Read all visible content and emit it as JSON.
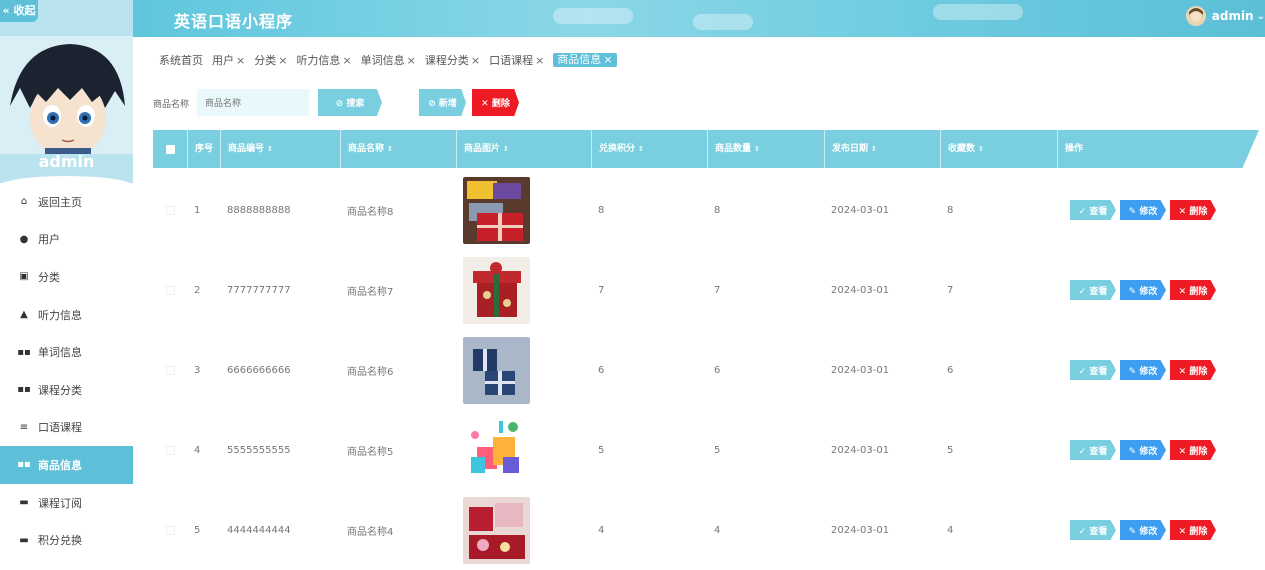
{
  "app": {
    "title": "英语口语小程序"
  },
  "user": {
    "name": "admin",
    "caret": "⌄"
  },
  "sidebar": {
    "collapse_label": "« 收起",
    "profile_name": "admin",
    "items": [
      {
        "label": "返回主页",
        "icon": "home-icon"
      },
      {
        "label": "用户",
        "icon": "user-pin-icon"
      },
      {
        "label": "分类",
        "icon": "clipboard-icon"
      },
      {
        "label": "听力信息",
        "icon": "person-icon"
      },
      {
        "label": "单词信息",
        "icon": "grid-icon"
      },
      {
        "label": "课程分类",
        "icon": "grid-icon"
      },
      {
        "label": "口语课程",
        "icon": "list-icon"
      },
      {
        "label": "商品信息",
        "icon": "grid-icon",
        "active": true
      },
      {
        "label": "课程订阅",
        "icon": "doc-icon"
      },
      {
        "label": "积分兑换",
        "icon": "chat-icon"
      }
    ]
  },
  "tabs": [
    {
      "label": "系统首页",
      "closable": false
    },
    {
      "label": "用户",
      "closable": true
    },
    {
      "label": "分类",
      "closable": true
    },
    {
      "label": "听力信息",
      "closable": true
    },
    {
      "label": "单词信息",
      "closable": true
    },
    {
      "label": "课程分类",
      "closable": true
    },
    {
      "label": "口语课程",
      "closable": true
    },
    {
      "label": "商品信息",
      "closable": true,
      "active": true
    }
  ],
  "tab_close": "×",
  "search": {
    "label": "商品名称",
    "placeholder": "商品名称",
    "search_button": "⊘ 搜索",
    "add_button": "⊘ 新增",
    "delete_button": "✕ 删除"
  },
  "table": {
    "headers": [
      "序号",
      "商品编号",
      "商品名称",
      "商品图片",
      "兑换积分",
      "商品数量",
      "发布日期",
      "收藏数",
      "操作"
    ],
    "sort_icon": "⇕",
    "rows": [
      {
        "index": "1",
        "code": "8888888888",
        "name": "商品名称8",
        "image": "gift-box-red",
        "points": "8",
        "quantity": "8",
        "date": "2024-03-01",
        "favorites": "8"
      },
      {
        "index": "2",
        "code": "7777777777",
        "name": "商品名称7",
        "image": "gift-box-christmas",
        "points": "7",
        "quantity": "7",
        "date": "2024-03-01",
        "favorites": "7"
      },
      {
        "index": "3",
        "code": "6666666666",
        "name": "商品名称6",
        "image": "gift-box-navy",
        "points": "6",
        "quantity": "6",
        "date": "2024-03-01",
        "favorites": "6"
      },
      {
        "index": "4",
        "code": "5555555555",
        "name": "商品名称5",
        "image": "gift-illustration",
        "points": "5",
        "quantity": "5",
        "date": "2024-03-01",
        "favorites": "5"
      },
      {
        "index": "5",
        "code": "4444444444",
        "name": "商品名称4",
        "image": "gift-box-pink",
        "points": "4",
        "quantity": "4",
        "date": "2024-03-01",
        "favorites": "4"
      }
    ],
    "actions": {
      "view": "✓ 查看",
      "edit": "✎ 修改",
      "delete": "✕ 删除"
    }
  },
  "colors": {
    "accent": "#5ec0d8",
    "danger": "#ee1b24",
    "edit": "#3d9ef1"
  }
}
